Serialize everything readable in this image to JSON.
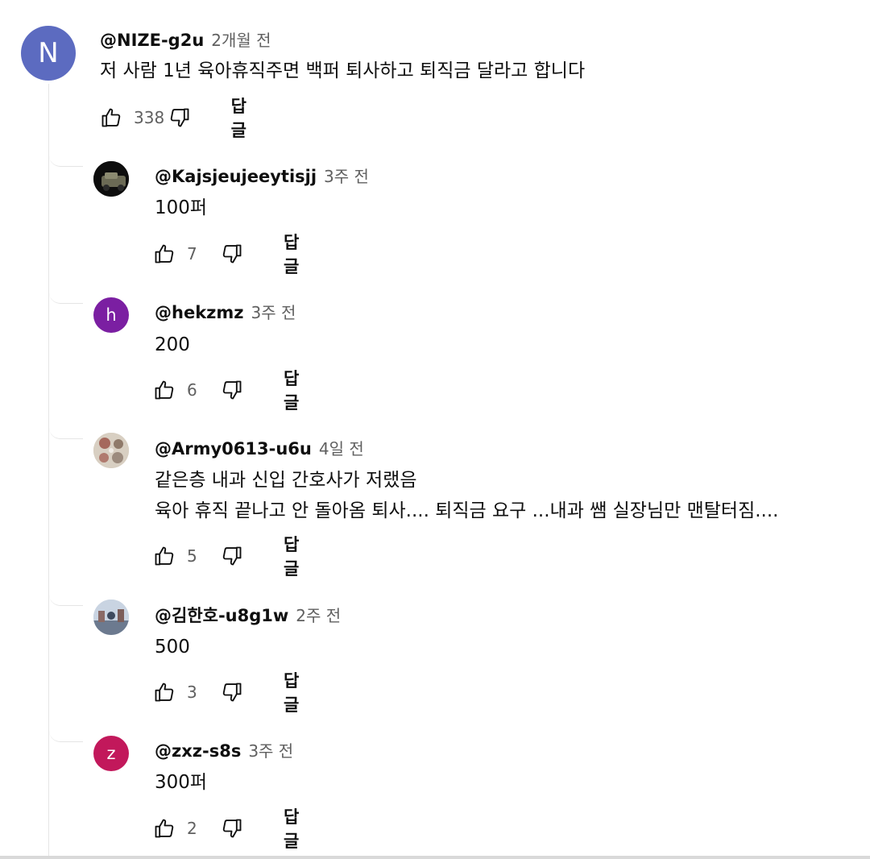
{
  "main_comment": {
    "avatar_letter": "N",
    "author": "@NIZE-g2u",
    "time": "2개월 전",
    "text": "저 사람 1년 육아휴직주면 백퍼 퇴사하고 퇴직금 달라고 합니다",
    "likes": "338",
    "reply_label": "답글",
    "avatar_color": "#5c6bc0"
  },
  "replies": [
    {
      "author": "@Kajsjeujeeytisjj",
      "time": "3주 전",
      "text_lines": [
        "100퍼"
      ],
      "likes": "7",
      "reply_label": "답글"
    },
    {
      "author": "@hekzmz",
      "time": "3주 전",
      "text_lines": [
        "200"
      ],
      "likes": "6",
      "reply_label": "답글",
      "avatar_letter": "h",
      "avatar_color": "#7b1fa2"
    },
    {
      "author": "@Army0613-u6u",
      "time": "4일 전",
      "text_lines": [
        "같은층 내과 신입 간호사가 저랬음",
        "육아 휴직 끝나고 안 돌아옴 퇴사.... 퇴직금 요구 ...내과 쌤 실장님만 맨탈터짐...."
      ],
      "likes": "5",
      "reply_label": "답글"
    },
    {
      "author": "@김한호-u8g1w",
      "time": "2주 전",
      "text_lines": [
        "500"
      ],
      "likes": "3",
      "reply_label": "답글"
    },
    {
      "author": "@zxz-s8s",
      "time": "3주 전",
      "text_lines": [
        "300퍼"
      ],
      "likes": "2",
      "reply_label": "답글",
      "avatar_letter": "z",
      "avatar_color": "#c2185b"
    }
  ],
  "icons": {
    "like": "thumbs-up-icon",
    "dislike": "thumbs-down-icon"
  }
}
